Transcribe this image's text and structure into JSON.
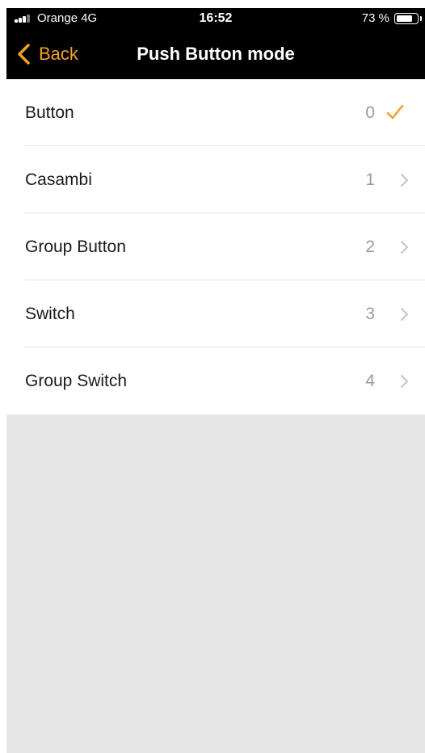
{
  "status_bar": {
    "carrier": "Orange  4G",
    "time": "16:52",
    "battery": "73 %"
  },
  "nav": {
    "back_label": "Back",
    "title": "Push Button mode"
  },
  "colors": {
    "accent": "#f0a030",
    "nav_background": "#000000",
    "list_background": "#ffffff",
    "empty_background": "#e6e6e6"
  },
  "list": {
    "items": [
      {
        "label": "Button",
        "value": "0",
        "selected": true
      },
      {
        "label": "Casambi",
        "value": "1",
        "selected": false
      },
      {
        "label": "Group Button",
        "value": "2",
        "selected": false
      },
      {
        "label": "Switch",
        "value": "3",
        "selected": false
      },
      {
        "label": "Group Switch",
        "value": "4",
        "selected": false
      }
    ]
  }
}
